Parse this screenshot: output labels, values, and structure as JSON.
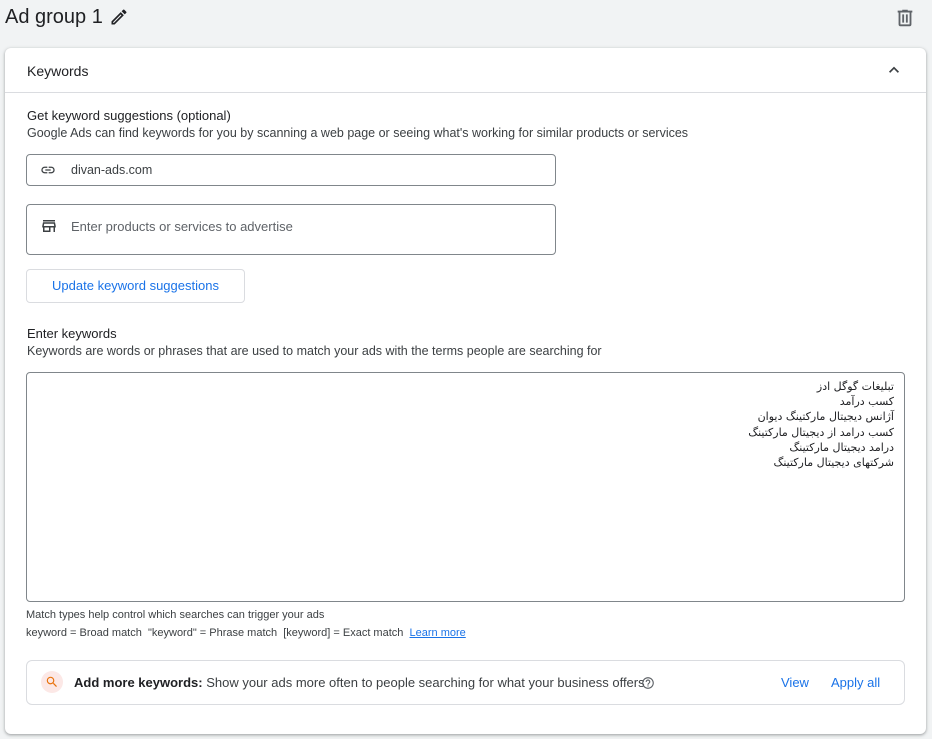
{
  "header": {
    "title": "Ad group 1"
  },
  "keywords_card": {
    "title": "Keywords",
    "suggestions": {
      "title": "Get keyword suggestions (optional)",
      "description": "Google Ads can find keywords for you by scanning a web page or seeing what's working for similar products or services",
      "url_value": "divan-ads.com",
      "products_placeholder": "Enter products or services to advertise",
      "update_button": "Update keyword suggestions"
    },
    "enter_keywords": {
      "title": "Enter keywords",
      "description": "Keywords are words or phrases that are used to match your ads with the terms people are searching for",
      "lines": [
        "تبلیغات گوگل ادز",
        "کسب درآمد",
        "آژانس دیجیتال مارکتینگ دیوان",
        "کسب درامد از دیجیتال مارکتینگ",
        "درامد دیجیتال مارکتینگ",
        "شرکتهای دیجیتال مارکتینگ"
      ]
    },
    "match_types": {
      "help": "Match types help control which searches can trigger your ads",
      "legend": "keyword = Broad match  \"keyword\" = Phrase match  [keyword] = Exact match",
      "learn_more": "Learn more"
    },
    "add_more": {
      "label": "Add more keywords:",
      "text": "Show your ads more often to people searching for what your business offers",
      "view": "View",
      "apply_all": "Apply all"
    }
  },
  "colors": {
    "accent": "#1a73e8",
    "border": "#dadce0",
    "search_bg": "#fce8e6",
    "search_icon": "#e8710a"
  },
  "icons": [
    "pencil-icon",
    "trash-icon",
    "chevron-up-icon",
    "link-icon",
    "storefront-icon",
    "search-icon",
    "help-icon"
  ]
}
